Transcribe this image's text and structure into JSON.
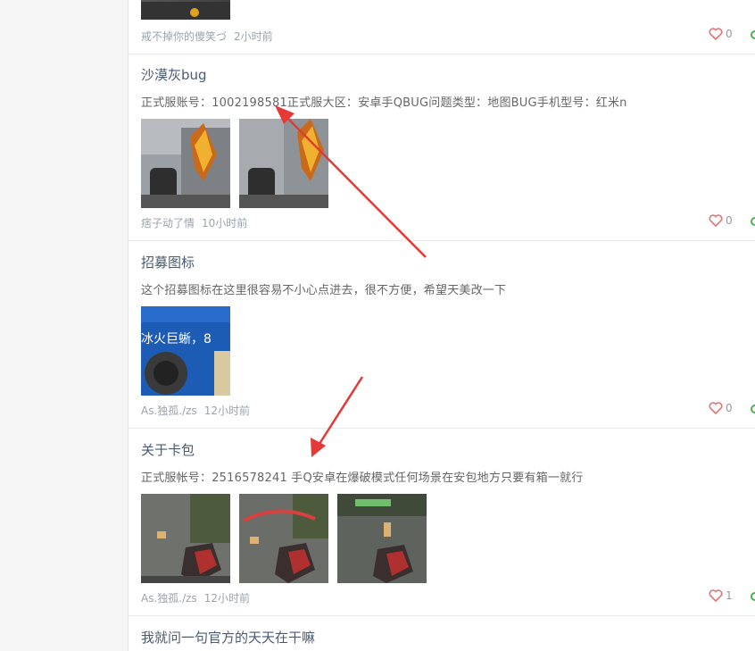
{
  "posts": [
    {
      "title": "",
      "author": "戒不掉你的傻笑づ",
      "time": "2小时前",
      "likes": "0"
    },
    {
      "title": "沙漠灰bug",
      "desc": "正式服账号：1002198581正式服大区：安卓手QBUG问题类型：地图BUG手机型号：红米n",
      "author": "痞子动了情",
      "time": "10小时前",
      "likes": "0"
    },
    {
      "title": "招募图标",
      "desc": "这个招募图标在这里很容易不小心点进去，很不方便，希望天美改一下",
      "image_text": "冰火巨蜥，8",
      "author": "As.独孤./zs",
      "time": "12小时前",
      "likes": "0"
    },
    {
      "title": "关于卡包",
      "desc": "正式服帐号：2516578241 手Q安卓在爆破模式任何场景在安包地方只要有箱一就行",
      "author": "As.独孤./zs",
      "time": "12小时前",
      "likes": "1"
    },
    {
      "title": "我就问一句官方的天天在干嘛"
    }
  ],
  "colors": {
    "title": "#4a5a72",
    "arrow": "#e53935",
    "like_heart": "#e57373",
    "status_dot": "#4caf50"
  },
  "icons": {
    "like": "heart-icon",
    "status": "circle-icon"
  }
}
